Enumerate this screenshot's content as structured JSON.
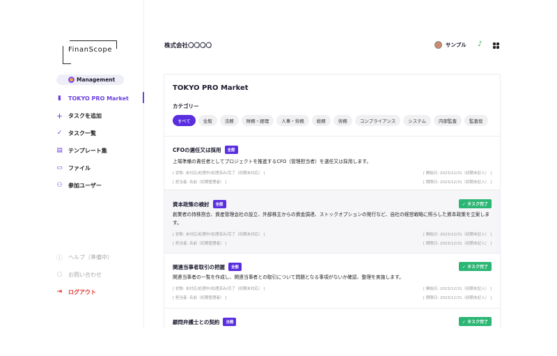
{
  "logo": {
    "text": "FinanScope"
  },
  "workspace": {
    "label": "Management"
  },
  "nav": [
    {
      "label": "TOKYO PRO Market",
      "icon": "bar-chart-icon"
    },
    {
      "label": "タスクを追加",
      "icon": "plus-icon"
    },
    {
      "label": "タスク一覧",
      "icon": "check-circle-icon"
    },
    {
      "label": "テンプレート集",
      "icon": "document-icon"
    },
    {
      "label": "ファイル",
      "icon": "folder-icon"
    },
    {
      "label": "参加ユーザー",
      "icon": "users-icon"
    }
  ],
  "footer_nav": [
    {
      "label": "ヘルプ（準備中）",
      "icon": "info-icon"
    },
    {
      "label": "お問い合わせ",
      "icon": "chat-icon"
    },
    {
      "label": "ログアウト",
      "icon": "logout-icon"
    }
  ],
  "header": {
    "company": "株式会社〇〇〇〇",
    "user": "サンプル",
    "icons": [
      "bell-icon",
      "apps-icon"
    ],
    "accent": "#2aa748"
  },
  "panel": {
    "title": "TOKYO PRO Market",
    "category_label": "カテゴリー"
  },
  "categories": [
    "すべて",
    "全般",
    "法務",
    "財務・経理",
    "人事・労務",
    "総務",
    "労務",
    "コンプライアンス",
    "システム",
    "内部監査",
    "監査役"
  ],
  "selected_category": "すべて",
  "colors": {
    "accent": "#5a2ee0",
    "done": "#2bb673",
    "logout": "#e0342f"
  },
  "tasks": [
    {
      "title": "CFOの選任又は採用",
      "tag": "全般",
      "done": "",
      "desc": "上場準備の責任者としてプロジェクトを推進するCFO（管理担当者）を選任又は採用します。",
      "status": "[ 状態: 未対応/処理中/処理済み/完了（初期未対応） ]",
      "owner": "[ 担当者: 名前（初期管理者） ]",
      "start": "[ 開始日: 2023/12/31（初期未記入） ]",
      "due": "[ 期限日: 2023/12/31（初期未記入） ]"
    },
    {
      "title": "資本政策の検討",
      "tag": "全般",
      "done": "タスク完了",
      "desc": "創業者の持株割合、資産管理会社の設立、外部株主からの資金調達、ストックオプションの発行など、自社の経営戦略に照らした資本政策を立案します。",
      "status": "[ 状態: 未対応/処理中/処理済み/完了（初期未対応） ]",
      "owner": "[ 担当者: 名前（初期管理者） ]",
      "start": "[ 開始日: 2023/12/31（初期未記入） ]",
      "due": "[ 期限日: 2023/12/31（初期未記入） ]"
    },
    {
      "title": "関連当事者取引の把握",
      "tag": "全般",
      "done": "タスク完了",
      "desc": "関連当事者の一覧を作成し、関連当事者との取引について問題となる事項がないか確認、整理を実施します。",
      "status": "[ 状態: 未対応/処理中/処理済み/完了（初期未対応） ]",
      "owner": "[ 担当者: 名前（初期管理者） ]",
      "start": "[ 開始日: 2023/12/31（初期未記入） ]",
      "due": "[ 期限日: 2023/12/31（初期未記入） ]"
    },
    {
      "title": "顧問弁護士との契約",
      "tag": "法務",
      "done": "タスク完了"
    }
  ]
}
